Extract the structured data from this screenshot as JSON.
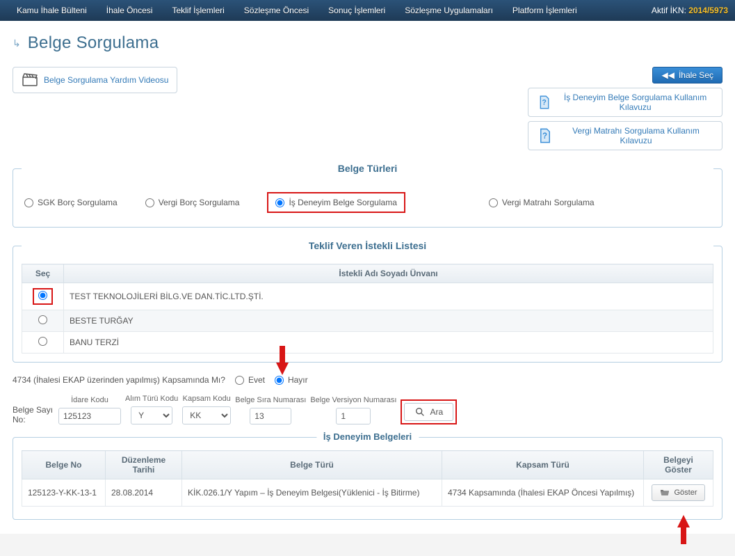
{
  "topbar": {
    "menus": [
      "Kamu İhale Bülteni",
      "İhale Öncesi",
      "Teklif İşlemleri",
      "Sözleşme Öncesi",
      "Sonuç İşlemleri",
      "Sözleşme Uygulamaları",
      "Platform İşlemleri"
    ],
    "aktif_ikn_label": "Aktif İKN:",
    "aktif_ikn_value": "2014/5973"
  },
  "page": {
    "title": "Belge Sorgulama"
  },
  "buttons": {
    "help_video": "Belge Sorgulama Yardım Videosu",
    "ihale_sec": "İhale Seç",
    "klavuz_is": "İş Deneyim Belge Sorgulama Kullanım Kılavuzu",
    "klavuz_vergi": "Vergi Matrahı Sorgulama Kullanım Kılavuzu",
    "ara": "Ara",
    "goster": "Göster"
  },
  "panels": {
    "belge_turleri": "Belge Türleri",
    "istekli_listesi": "Teklif Veren İstekli Listesi",
    "belgeler": "İş Deneyim Belgeleri"
  },
  "belge_types": {
    "sgk": "SGK Borç Sorgulama",
    "vergi_borc": "Vergi Borç Sorgulama",
    "is_deneyim": "İş Deneyim Belge Sorgulama",
    "vergi_matrah": "Vergi Matrahı Sorgulama"
  },
  "istekli_table": {
    "col_sec": "Seç",
    "col_ad": "İstekli Adı Soyadı Ünvanı",
    "rows": [
      "TEST TEKNOLOJİLERİ BİLG.VE DAN.TİC.LTD.ŞTİ.",
      "BESTE TURĞAY",
      "BANU TERZİ"
    ]
  },
  "kapsam": {
    "question": "4734 (İhalesi EKAP üzerinden yapılmış) Kapsamında Mı?",
    "evet": "Evet",
    "hayir": "Hayır"
  },
  "fields": {
    "side_label": "Belge Sayı No:",
    "idare_kodu": {
      "label": "İdare Kodu",
      "value": "125123"
    },
    "alim_turu": {
      "label": "Alım Türü Kodu",
      "value": "Y"
    },
    "kapsam_kodu": {
      "label": "Kapsam Kodu",
      "value": "KK"
    },
    "belge_sira": {
      "label": "Belge Sıra Numarası",
      "value": "13"
    },
    "belge_versiyon": {
      "label": "Belge Versiyon Numarası",
      "value": "1"
    }
  },
  "result_table": {
    "cols": {
      "belge_no": "Belge No",
      "tarih": "Düzenleme Tarihi",
      "tur": "Belge Türü",
      "kapsam": "Kapsam Türü",
      "goster": "Belgeyi Göster"
    },
    "row": {
      "belge_no": "125123-Y-KK-13-1",
      "tarih": "28.08.2014",
      "tur": "KİK.026.1/Y Yapım – İş Deneyim Belgesi(Yüklenici - İş Bitirme)",
      "kapsam": "4734 Kapsamında (İhalesi EKAP Öncesi Yapılmış)"
    }
  }
}
